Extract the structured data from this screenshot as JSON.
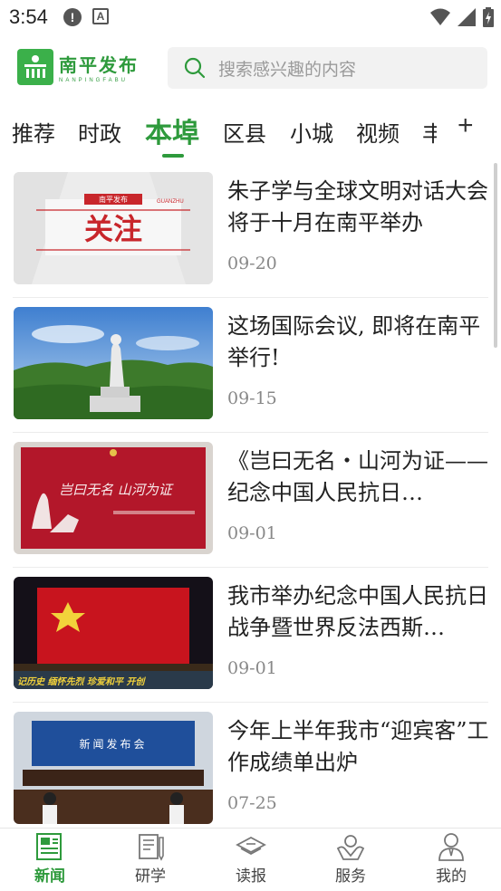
{
  "status_bar": {
    "time": "3:54",
    "alert_icon": "alert-circle-icon",
    "a_icon": "A",
    "right_icons": [
      "wifi-icon",
      "signal-icon",
      "battery-charging-icon"
    ]
  },
  "header": {
    "logo_cn": "南平发布",
    "logo_en": "NANPINGFABU",
    "search_placeholder": "搜索感兴趣的内容"
  },
  "tabs": [
    "推荐",
    "时政",
    "本埠",
    "区县",
    "小城",
    "视频",
    "丰"
  ],
  "active_tab": "本埠",
  "tab_add": "+",
  "news": [
    {
      "title": "朱子学与全球文明对话大会将于十月在南平举办",
      "date": "09-20",
      "thumb_text_top": "南平发布",
      "thumb_text_main": "关注",
      "thumb_text_side": "GUANZHU"
    },
    {
      "title": "这场国际会议, 即将在南平举行!",
      "date": "09-15"
    },
    {
      "title": "《岂曰无名・山河为证——纪念中国人民抗日…",
      "date": "09-01",
      "thumb_text": "岂曰无名 山河为证"
    },
    {
      "title": "我市举办纪念中国人民抗日战争暨世界反法西斯…",
      "date": "09-01",
      "thumb_text": "记历史 缅怀先烈 珍爱和平 开创"
    },
    {
      "title": "今年上半年我市“迎宾客”工作成绩单出炉",
      "date": "07-25",
      "thumb_text": "新闻发布会"
    }
  ],
  "bottom_nav": [
    {
      "label": "新闻",
      "icon": "newspaper-icon",
      "active": true
    },
    {
      "label": "研学",
      "icon": "study-notes-icon",
      "active": false
    },
    {
      "label": "读报",
      "icon": "read-paper-icon",
      "active": false
    },
    {
      "label": "服务",
      "icon": "service-hands-icon",
      "active": false
    },
    {
      "label": "我的",
      "icon": "user-icon",
      "active": false
    }
  ],
  "colors": {
    "accent": "#2e9a3c",
    "logo_green": "#3bb04a"
  }
}
